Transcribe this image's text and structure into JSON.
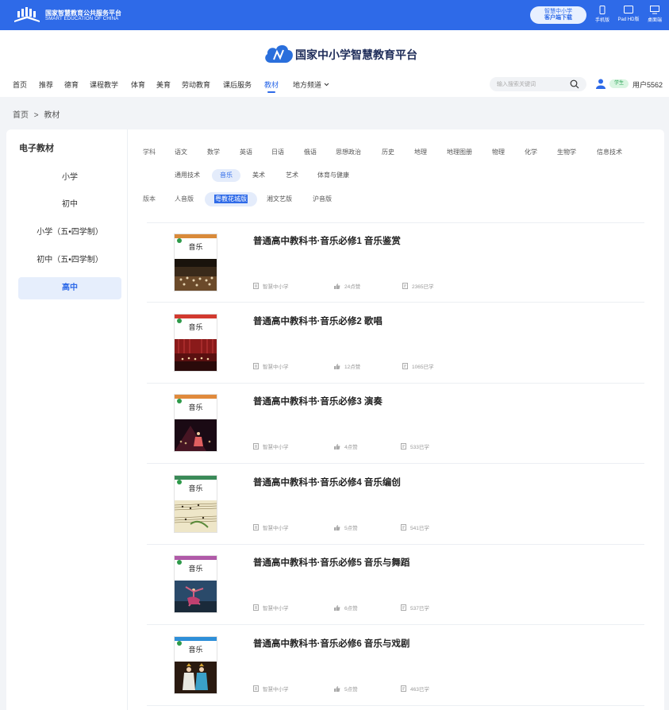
{
  "topbar": {
    "brand_cn": "国家智慧教育公共服务平台",
    "brand_en": "SMART EDUCATION OF CHINA",
    "download_line1": "智慧中小学",
    "download_line2": "客户端下载",
    "devices": [
      {
        "label": "手机版",
        "icon": "phone-icon"
      },
      {
        "label": "Pad HD版",
        "icon": "tablet-icon"
      },
      {
        "label": "桌面端",
        "icon": "desktop-icon"
      }
    ]
  },
  "header": {
    "site_title": "国家中小学智慧教育平台",
    "nav": [
      "首页",
      "推荐",
      "德育",
      "课程教学",
      "体育",
      "美育",
      "劳动教育",
      "课后服务",
      "教材",
      "地方频道"
    ],
    "nav_active": "教材",
    "search_placeholder": "输入搜索关键词",
    "role_badge": "学生",
    "username": "用户5562"
  },
  "breadcrumb": [
    "首页",
    ">",
    "教材"
  ],
  "sidebar": {
    "title": "电子教材",
    "items": [
      "小学",
      "初中",
      "小学（五•四学制）",
      "初中（五•四学制）",
      "高中"
    ],
    "active": "高中"
  },
  "filters": {
    "subject_label": "学科",
    "subjects_row1": [
      "语文",
      "数学",
      "英语",
      "日语",
      "俄语",
      "思想政治",
      "历史",
      "地理",
      "地理图册",
      "物理",
      "化学",
      "生物学",
      "信息技术"
    ],
    "subjects_row2": [
      "通用技术",
      "音乐",
      "美术",
      "艺术",
      "体育与健康"
    ],
    "subject_active": "音乐",
    "edition_label": "版本",
    "editions": [
      "人音版",
      "粤教花城版",
      "湘文艺版",
      "沪音版"
    ],
    "edition_active": "粤教花城版"
  },
  "books": [
    {
      "title": "普通高中教科书·音乐必修1 音乐鉴赏",
      "publisher": "智慧中小学",
      "likes": "24点赞",
      "learners": "2365已学",
      "band_color": "#d98a3a",
      "cover_title": "音乐"
    },
    {
      "title": "普通高中教科书·音乐必修2 歌唱",
      "publisher": "智慧中小学",
      "likes": "12点赞",
      "learners": "1065已学",
      "band_color": "#d23a2f",
      "cover_title": "音乐"
    },
    {
      "title": "普通高中教科书·音乐必修3 演奏",
      "publisher": "智慧中小学",
      "likes": "4点赞",
      "learners": "533已学",
      "band_color": "#e08a3c",
      "cover_title": "音乐"
    },
    {
      "title": "普通高中教科书·音乐必修4 音乐编创",
      "publisher": "智慧中小学",
      "likes": "5点赞",
      "learners": "541已学",
      "band_color": "#3a8a58",
      "cover_title": "音乐"
    },
    {
      "title": "普通高中教科书·音乐必修5 音乐与舞蹈",
      "publisher": "智慧中小学",
      "likes": "6点赞",
      "learners": "537已学",
      "band_color": "#b05aa8",
      "cover_title": "音乐"
    },
    {
      "title": "普通高中教科书·音乐必修6 音乐与戏剧",
      "publisher": "智慧中小学",
      "likes": "5点赞",
      "learners": "463已学",
      "band_color": "#2e8fd8",
      "cover_title": "音乐"
    }
  ]
}
